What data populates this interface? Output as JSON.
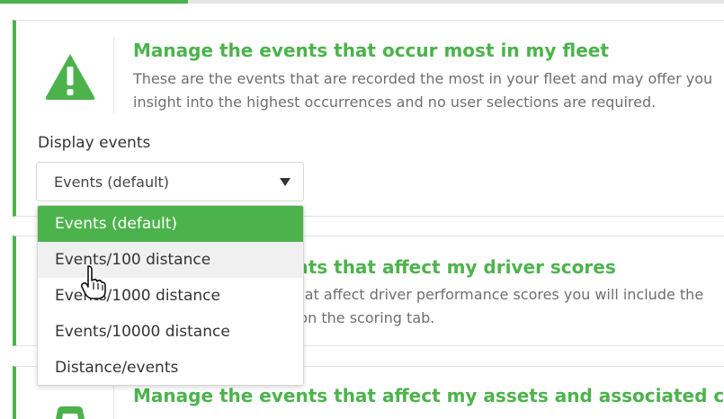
{
  "colors": {
    "accent": "#4cb34c",
    "border": "#e2e2e2",
    "muted_text": "#6f6f6f"
  },
  "progress": {
    "fraction": 0.26
  },
  "cards": [
    {
      "title": "Manage the events that occur most in my fleet",
      "description": "These are the events that are recorded the most in your fleet and may offer you insight into the highest occurrences and no user selections are required.",
      "icon": "warning-triangle-icon"
    },
    {
      "title": "Manage the events that affect my driver scores",
      "description": "These are the events that affect driver performance scores you will include the ones that are selected on the scoring tab.",
      "icon": "driver-score-icon"
    },
    {
      "title": "Manage the events that affect my assets and associated costs",
      "icon": "asset-icon"
    }
  ],
  "filter": {
    "label": "Display events",
    "selected": "Events (default)",
    "options": [
      "Events (default)",
      "Events/100 distance",
      "Events/1000 distance",
      "Events/10000 distance",
      "Distance/events"
    ],
    "highlighted_index": 0,
    "hover_index": 1
  },
  "cursor": "hand-pointer-icon"
}
